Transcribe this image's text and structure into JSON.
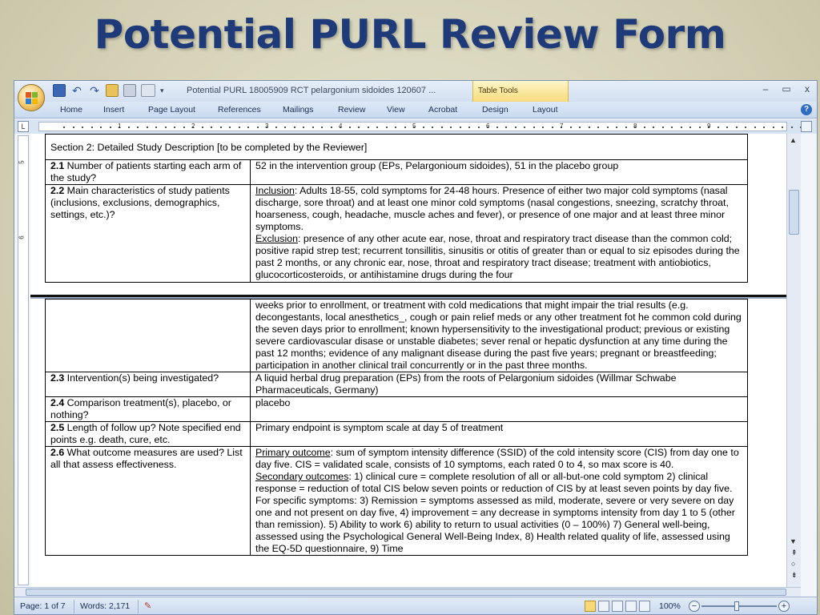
{
  "slide": {
    "title": "Potential PURL Review Form"
  },
  "window": {
    "doc_title": "Potential PURL 18005909 RCT pelargonium sidoides 120607 ...",
    "contextual_tab": "Table Tools",
    "controls": {
      "minimize": "–",
      "restore": "▭",
      "close": "x"
    }
  },
  "ribbon": {
    "tabs": [
      "Home",
      "Insert",
      "Page Layout",
      "References",
      "Mailings",
      "Review",
      "View",
      "Acrobat",
      "Design",
      "Layout"
    ]
  },
  "ruler": {
    "tab_selector": "L",
    "numbers": [
      "1",
      "2",
      "3",
      "4",
      "5",
      "6",
      "7",
      "8",
      "9"
    ],
    "vertical_numbers": [
      "5",
      "6"
    ]
  },
  "document": {
    "section_header": "Section 2: Detailed Study Description [to be completed by the Reviewer]",
    "rows": {
      "r21": {
        "num": "2.1",
        "label": " Number of patients starting each arm of the study?",
        "value": "52 in the intervention group (EPs, Pelargonioum sidoides),  51 in the placebo group"
      },
      "r22": {
        "num": "2.2",
        "label": " Main characteristics of study patients (inclusions, exclusions, demographics, settings, etc.)?",
        "inclusion_label": "Inclusion",
        "inclusion_text": ": Adults 18-55, cold symptoms for 24-48 hours. Presence of either two major cold symptoms (nasal discharge, sore throat) and at least one minor cold symptoms (nasal congestions, sneezing, scratchy throat, hoarseness, cough, headache, muscle aches and fever), or presence of one major and at least three minor symptoms.",
        "exclusion_label": "Exclusion",
        "exclusion_text": ": presence of any other acute ear, nose, throat and respiratory tract disease than the common cold; positive rapid strep test; recurrent tonsillitis, sinusitis or otitis of greater than or equal to siz episodes during the past 2 months, or any chronic ear, nose, throat and respiratory tract disease; treatment with antiobiotics, glucocorticosteroids, or antihistamine drugs during the four",
        "continuation": "weeks prior to enrollment, or treatment with cold medications that might impair the trial results (e.g. decongestants, local anesthetics_, cough or pain relief meds or any other treatment fot he common cold during the seven days prior to enrollment; known hypersensitivity to the investigational product; previous or existing severe cardiovascular disase or unstable diabetes; sever renal or hepatic dysfunction at any time during the past 12 months; evidence of any malignant disease during the past five years; pregnant or breastfeeding; participation in another clinical trail concurrently or in the past three months."
      },
      "r23": {
        "num": "2.3",
        "label": " Intervention(s) being investigated?",
        "value": "A liquid herbal drug preparation (EPs) from the roots of Pelargonium sidoides (Willmar Schwabe Pharmaceuticals, Germany)"
      },
      "r24": {
        "num": "2.4",
        "label": " Comparison treatment(s), placebo, or nothing?",
        "value": "placebo"
      },
      "r25": {
        "num": "2.5",
        "label": " Length of follow up? Note specified end points e.g. death, cure, etc.",
        "value": "Primary endpoint is symptom scale at day 5 of treatment"
      },
      "r26": {
        "num": "2.6",
        "label": " What outcome measures are used? List all that assess effectiveness.",
        "primary_label": "Primary outcome",
        "primary_text": ": sum of symptom intensity difference (SSID) of the cold intensity score (CIS) from day one to day five. CIS = validated scale, consists of 10 symptoms, each rated 0 to 4, so max score is 40.",
        "secondary_label": "Secondary outcomes",
        "secondary_text": ": 1) clinical cure = complete resolution of all or all-but-one cold symptom 2) clinical response = reduction of total CIS below seven points or reduction of CIS by at least seven points by day five. For specific symptoms:  3) Remission = symptoms assessed as mild, moderate, severe or very severe on day one and not present on day five, 4) improvement = any decrease in symptoms intensity from day 1 to 5 (other than remission). 5) Ability to work 6) ability to return to usual activities (0 – 100%)  7) General well-being, assessed using the Psychological General Well-Being Index, 8) Health related quality of life, assessed using the EQ-5D questionnaire, 9) Time"
      }
    }
  },
  "statusbar": {
    "page": "Page: 1 of 7",
    "words": "Words: 2,171",
    "zoom": "100%",
    "zoom_minus": "−",
    "zoom_plus": "+"
  },
  "colors": {
    "slide_title": "#1f3a78",
    "table_tools": "#f6dc7c",
    "ribbon": "#c9daf0"
  }
}
